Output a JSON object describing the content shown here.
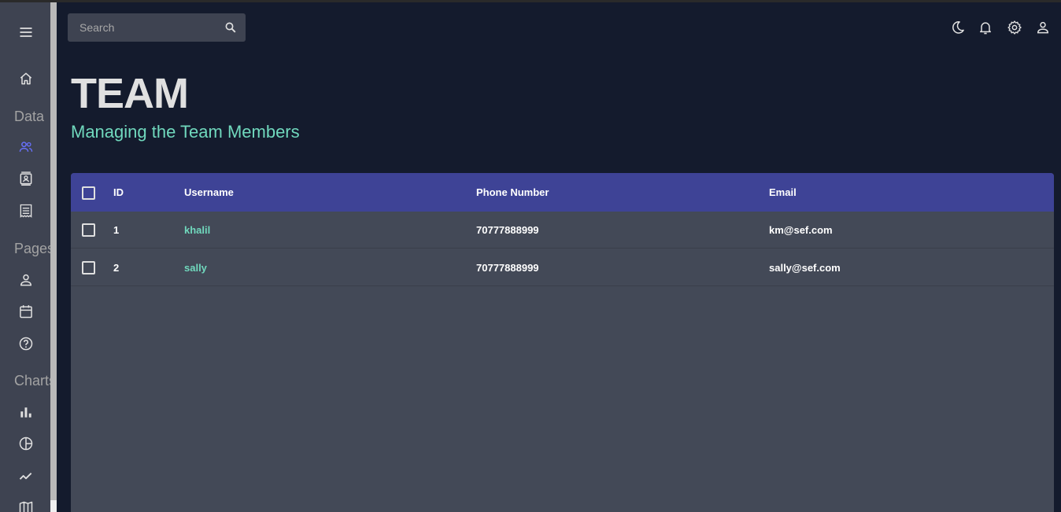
{
  "search": {
    "placeholder": "Search"
  },
  "sidebar": {
    "sections": [
      "Data",
      "Pages",
      "Charts"
    ],
    "items": [
      {
        "icon": "menu-icon"
      },
      {
        "icon": "home-icon"
      },
      {
        "icon": "team-icon",
        "active": true
      },
      {
        "icon": "contacts-icon"
      },
      {
        "icon": "invoices-icon"
      },
      {
        "icon": "profile-form-icon"
      },
      {
        "icon": "calendar-icon"
      },
      {
        "icon": "faq-icon"
      },
      {
        "icon": "bar-chart-icon"
      },
      {
        "icon": "pie-chart-icon"
      },
      {
        "icon": "line-chart-icon"
      },
      {
        "icon": "geography-icon"
      }
    ]
  },
  "topbar": {
    "icons": [
      "dark-mode-icon",
      "notifications-icon",
      "settings-icon",
      "user-icon"
    ]
  },
  "header": {
    "title": "TEAM",
    "subtitle": "Managing the Team Members"
  },
  "table": {
    "columns": [
      "ID",
      "Username",
      "Phone Number",
      "Email"
    ],
    "rows": [
      {
        "id": "1",
        "username": "khalil",
        "phone": "70777888999",
        "email": "km@sef.com"
      },
      {
        "id": "2",
        "username": "sally",
        "phone": "70777888999",
        "email": "sally@sef.com"
      }
    ]
  },
  "colors": {
    "background": "#141b2d",
    "sidebar": "#3e4351",
    "accent": "#70d8bd",
    "header": "#3e4396",
    "active_icon": "#6870fa"
  }
}
